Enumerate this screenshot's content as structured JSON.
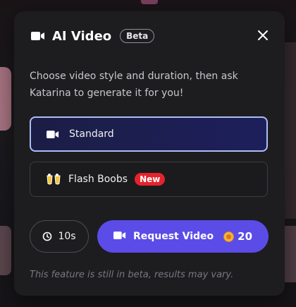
{
  "modal": {
    "title": "AI Video",
    "badge": "Beta",
    "description": "Choose video style and duration, then ask Katarina to generate it for you!",
    "options": [
      {
        "label": "Standard",
        "icon": "video-camera-icon",
        "selected": true
      },
      {
        "label": "Flash Boobs",
        "icon": "cheers-icon",
        "badge": "New",
        "selected": false
      }
    ],
    "duration": {
      "label": "10s",
      "icon": "clock-icon"
    },
    "request": {
      "label": "Request Video",
      "icon": "video-camera-icon",
      "cost": "20",
      "cost_icon": "coin-icon"
    },
    "footer_note": "This feature is still in beta, results may vary."
  },
  "colors": {
    "accent": "#5b4ce8",
    "selected_border": "#aebdf3",
    "new_badge": "#e5232c",
    "modal_bg": "#1d1d20"
  }
}
